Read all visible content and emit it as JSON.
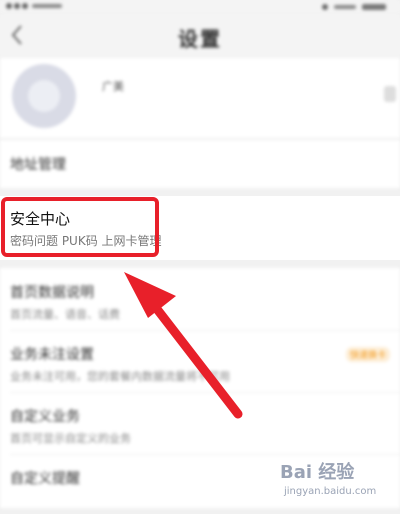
{
  "nav": {
    "title": "设置",
    "back_icon": "chevron-left-icon"
  },
  "profile": {
    "name": "广美"
  },
  "rows": {
    "address": {
      "title": "地址管理"
    },
    "security": {
      "title": "安全中心",
      "subtitle": "密码问题 PUK码 上网卡管理"
    }
  },
  "group_items": [
    {
      "title": "首页数据说明",
      "subtitle": "首页流量、语音、话费",
      "tag": ""
    },
    {
      "title": "业务未注设置",
      "subtitle": "业务未注可用，您的套餐内数据流量将不可用",
      "tag": "快速换卡"
    },
    {
      "title": "自定义业务",
      "subtitle": "首页可显示自定义的业务",
      "tag": ""
    },
    {
      "title": "自定义提醒",
      "subtitle": "",
      "tag": ""
    }
  ],
  "watermark": {
    "logo": "Bai 经验",
    "url": "jingyan.baidu.com"
  },
  "colors": {
    "highlight_red": "#e8202a",
    "accent_orange": "#f39a1e"
  }
}
